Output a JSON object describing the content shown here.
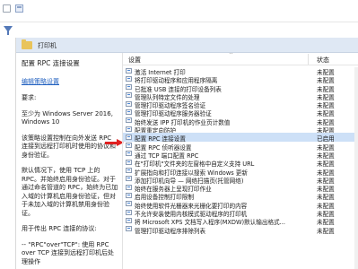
{
  "header": {
    "title": "打印机"
  },
  "description": {
    "title": "配置 RPC 连接设置",
    "edit_link": "编辑策略设置",
    "requirements_label": "要求:",
    "requirements_value": "至少为 Windows Server 2016, Windows 10",
    "body1": "该策略设置控制在向外发送 RPC 连接到远程打印机时使用的协议和身份验证。",
    "body2": "默认情况下，使用 TCP 上的 RPC。并始终启用身份验证。对于通过命名管道的 RPC，始终为已加入域的计算机启用身份验证，但对于未加入域的计算机禁用身份验证。",
    "body3": "用于传出 RPC 连接的协议:",
    "body4": "-- \"RPC\"over\"TCP\": 使用 RPC over TCP 连接到远程打印机后处理操作"
  },
  "columns": {
    "setting": "设置",
    "state": "状态"
  },
  "rows": [
    {
      "name": "激活 Internet 打印",
      "state": "未配置"
    },
    {
      "name": "将打印驱动程序和应用程序隔离",
      "state": "未配置"
    },
    {
      "name": "已批准 USB 连接的打印设备列表",
      "state": "未配置"
    },
    {
      "name": "管理队列特定文件的处理",
      "state": "未配置"
    },
    {
      "name": "管理打印驱动程序签名验证",
      "state": "未配置"
    },
    {
      "name": "管理打印驱动程序服务器验证",
      "state": "未配置"
    },
    {
      "name": "始终发送 IPP 打印机的作业页计数值",
      "state": "未配置"
    },
    {
      "name": "配置重定向防护",
      "state": "未配置"
    },
    {
      "name": "配置 RPC 连接设置",
      "state": "已启用"
    },
    {
      "name": "配置 RPC 侦听器设置",
      "state": "未配置"
    },
    {
      "name": "通过 TCP 端口配置 RPC",
      "state": "未配置"
    },
    {
      "name": "在\"打印机\"文件夹的左窗格中自定义支持 URL",
      "state": "未配置"
    },
    {
      "name": "扩展指向和打印连接以搜索 Windows 更新",
      "state": "未配置"
    },
    {
      "name": "添加打印机向导 — 网络扫描页(托管网络)",
      "state": "未配置"
    },
    {
      "name": "始终在服务器上呈现打印作业",
      "state": "未配置"
    },
    {
      "name": "启用设备控制打印限制",
      "state": "未配置"
    },
    {
      "name": "始终使用软件光栅器来光栅化要打印的内容",
      "state": "未配置"
    },
    {
      "name": "不允许安装使用内核模式驱动程序的打印机",
      "state": "未配置"
    },
    {
      "name": "将 Microsoft XPS 文档写入程序(MXDW)默认输出格式...",
      "state": "未配置"
    },
    {
      "name": "管理打印驱动程序排除列表",
      "state": "未配置"
    }
  ]
}
